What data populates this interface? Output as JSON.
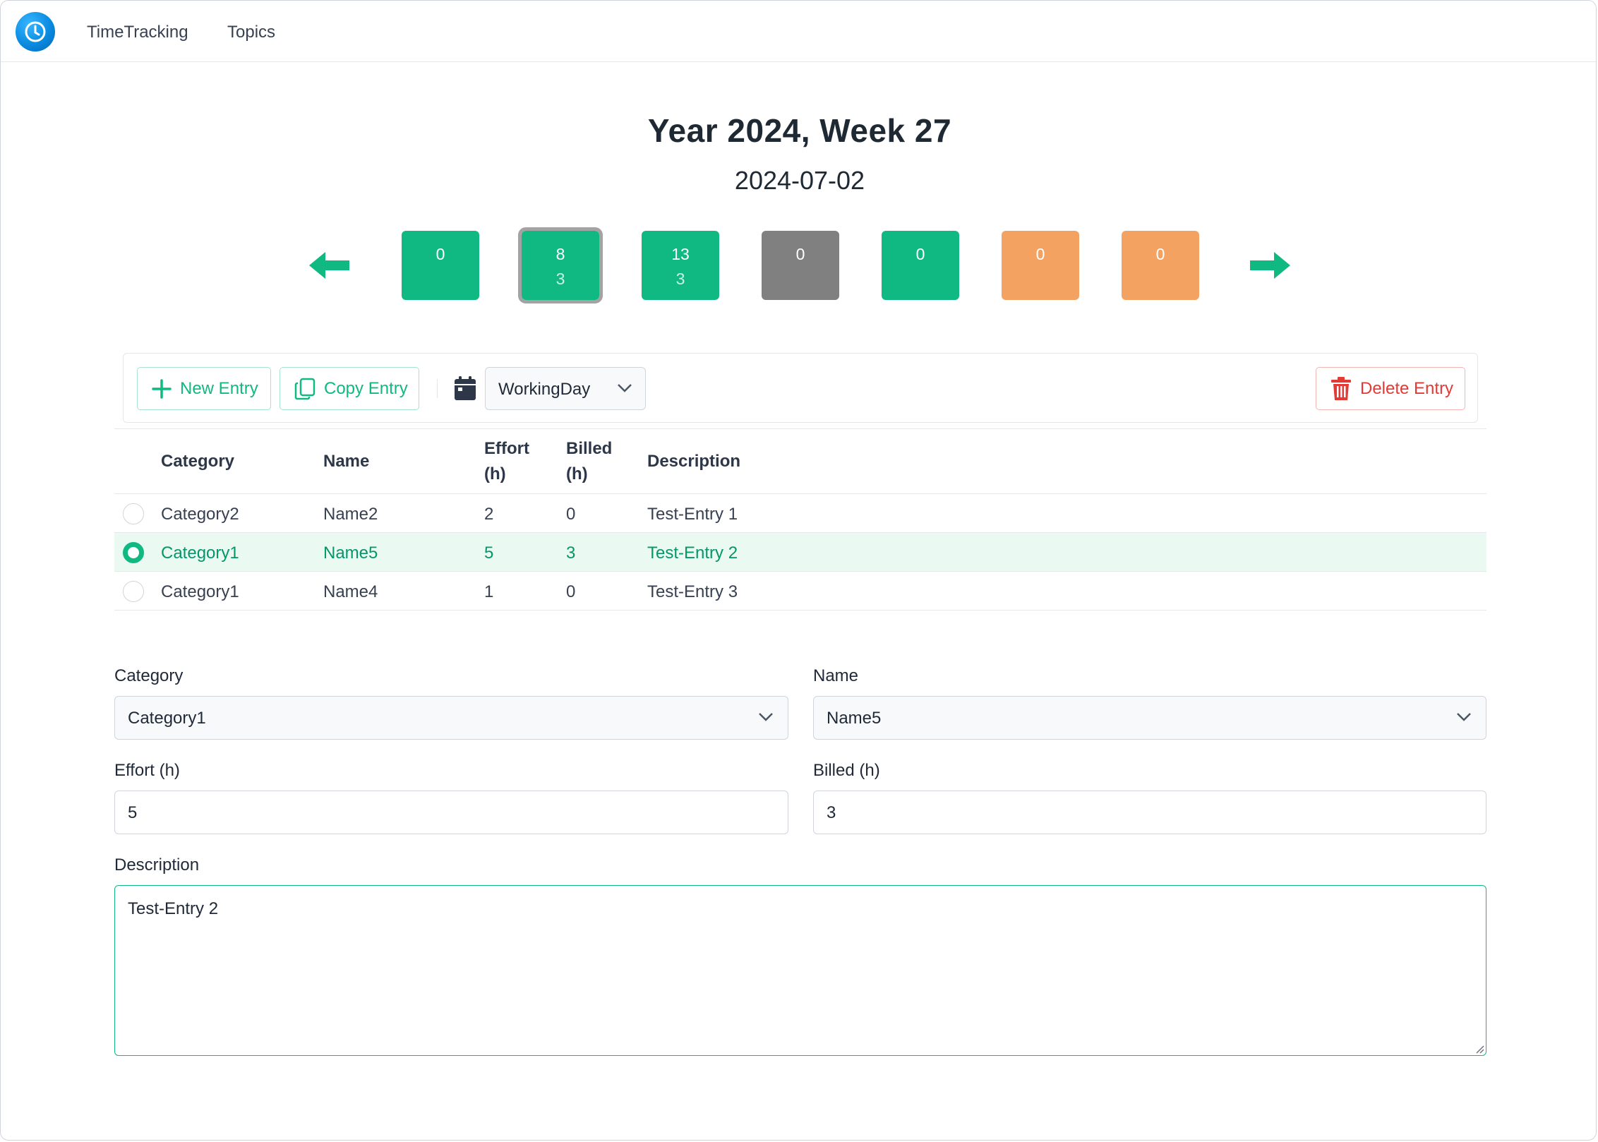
{
  "nav": {
    "links": [
      "TimeTracking",
      "Topics"
    ]
  },
  "header": {
    "title": "Year 2024, Week 27",
    "date": "2024-07-02"
  },
  "days": [
    {
      "effort": "0",
      "billed": "",
      "color": "#10b981"
    },
    {
      "effort": "8",
      "billed": "3",
      "color": "#10b981",
      "selected": true
    },
    {
      "effort": "13",
      "billed": "3",
      "color": "#10b981"
    },
    {
      "effort": "0",
      "billed": "",
      "color": "#808080"
    },
    {
      "effort": "0",
      "billed": "",
      "color": "#10b981"
    },
    {
      "effort": "0",
      "billed": "",
      "color": "#f4a261"
    },
    {
      "effort": "0",
      "billed": "",
      "color": "#f4a261"
    }
  ],
  "toolbar": {
    "new_label": "New Entry",
    "copy_label": "Copy Entry",
    "day_type": "WorkingDay",
    "delete_label": "Delete Entry"
  },
  "table": {
    "headers": {
      "category": "Category",
      "name": "Name",
      "effort_1": "Effort",
      "effort_2": "(h)",
      "billed_1": "Billed",
      "billed_2": "(h)",
      "description": "Description"
    },
    "rows": [
      {
        "category": "Category2",
        "name": "Name2",
        "effort": "2",
        "billed": "0",
        "description": "Test-Entry 1"
      },
      {
        "category": "Category1",
        "name": "Name5",
        "effort": "5",
        "billed": "3",
        "description": "Test-Entry 2"
      },
      {
        "category": "Category1",
        "name": "Name4",
        "effort": "1",
        "billed": "0",
        "description": "Test-Entry 3"
      }
    ]
  },
  "form": {
    "category_label": "Category",
    "category_value": "Category1",
    "name_label": "Name",
    "name_value": "Name5",
    "effort_label": "Effort (h)",
    "effort_value": "5",
    "billed_label": "Billed (h)",
    "billed_value": "3",
    "description_label": "Description",
    "description_value": "Test-Entry 2"
  },
  "colors": {
    "accent": "#10b981",
    "danger": "#e53935",
    "weekend": "#f4a261",
    "holiday": "#808080"
  }
}
